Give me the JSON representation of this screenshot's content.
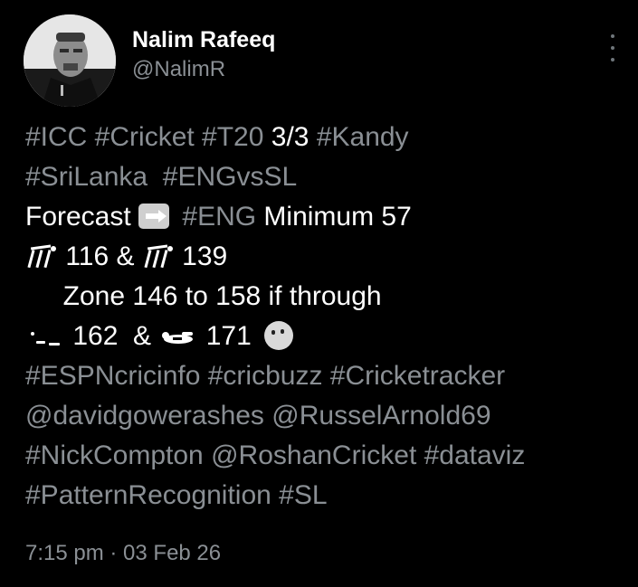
{
  "author": {
    "name": "Nalim Rafeeq",
    "handle": "@NalimR"
  },
  "tweet": {
    "line1": {
      "tags_a": "#ICC #Cricket #T20",
      "text": " 3/3 ",
      "tags_b": "#Kandy"
    },
    "line2": {
      "tags": "#SriLanka  #ENGvsSL"
    },
    "line3": {
      "text_a": "Forecast ",
      "tag": " #ENG",
      "text_b": " Minimum 57"
    },
    "line4": {
      "a": " 116 & ",
      "b": " 139"
    },
    "line5": {
      "text": "     Zone 146 to 158 if through"
    },
    "line6": {
      "a": " 162  & ",
      "b": " 171 "
    },
    "line7": "#ESPNcricinfo #cricbuzz #Cricketracker",
    "line8": "@davidgowerashes @RusselArnold69",
    "line9": "#NickCompton @RoshanCricket #dataviz",
    "line10": "#PatternRecognition #SL"
  },
  "icons": [
    "right-arrow-emoji-icon",
    "cricket-stumps-icon",
    "fielder-diving-icon",
    "thinking-face-icon",
    "more-options-icon"
  ],
  "timestamp": "7:15 pm · 03 Feb 26",
  "colors": {
    "background": "#000000",
    "text": "#ffffff",
    "muted": "#8a8f94"
  }
}
